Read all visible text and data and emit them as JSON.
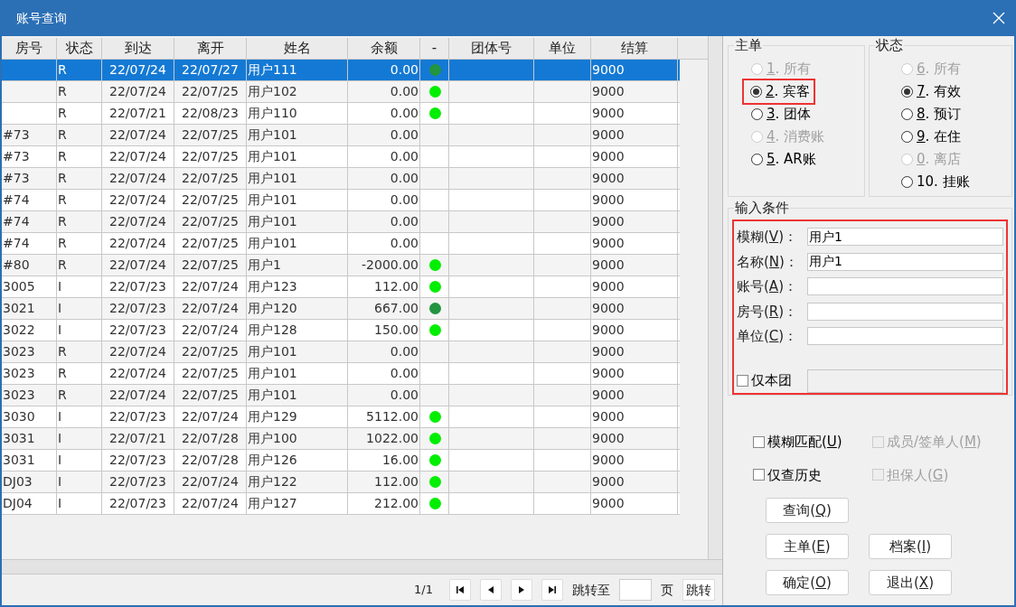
{
  "window": {
    "title": "账号查询"
  },
  "table": {
    "columns": [
      "房号",
      "状态",
      "到达",
      "离开",
      "姓名",
      "余额",
      "-",
      "团体号",
      "单位",
      "结算"
    ],
    "rows": [
      {
        "selected": true,
        "cells": [
          "",
          "R",
          "22/07/24",
          "22/07/27",
          "用户111",
          "0.00",
          "",
          "",
          "",
          "9000"
        ],
        "color": "#23943f"
      },
      {
        "selected": false,
        "cells": [
          "",
          "R",
          "22/07/24",
          "22/07/25",
          "用户102",
          "0.00",
          "",
          "",
          "",
          "9000"
        ],
        "color": "#00ee00"
      },
      {
        "selected": false,
        "cells": [
          "",
          "R",
          "22/07/21",
          "22/08/23",
          "用户110",
          "0.00",
          "",
          "",
          "",
          "9000"
        ],
        "color": "#00ee00"
      },
      {
        "selected": false,
        "cells": [
          "#73",
          "R",
          "22/07/24",
          "22/07/25",
          "用户101",
          "0.00",
          "",
          "",
          "",
          "9000"
        ]
      },
      {
        "selected": false,
        "cells": [
          "#73",
          "R",
          "22/07/24",
          "22/07/25",
          "用户101",
          "0.00",
          "",
          "",
          "",
          "9000"
        ]
      },
      {
        "selected": false,
        "cells": [
          "#73",
          "R",
          "22/07/24",
          "22/07/25",
          "用户101",
          "0.00",
          "",
          "",
          "",
          "9000"
        ]
      },
      {
        "selected": false,
        "cells": [
          "#74",
          "R",
          "22/07/24",
          "22/07/25",
          "用户101",
          "0.00",
          "",
          "",
          "",
          "9000"
        ]
      },
      {
        "selected": false,
        "cells": [
          "#74",
          "R",
          "22/07/24",
          "22/07/25",
          "用户101",
          "0.00",
          "",
          "",
          "",
          "9000"
        ]
      },
      {
        "selected": false,
        "cells": [
          "#74",
          "R",
          "22/07/24",
          "22/07/25",
          "用户101",
          "0.00",
          "",
          "",
          "",
          "9000"
        ]
      },
      {
        "selected": false,
        "cells": [
          "#80",
          "R",
          "22/07/24",
          "22/07/25",
          "用户1",
          "-2000.00",
          "",
          "",
          "",
          "9000"
        ],
        "color": "#00ee00"
      },
      {
        "selected": false,
        "cells": [
          "3005",
          "I",
          "22/07/23",
          "22/07/24",
          "用户123",
          "112.00",
          "",
          "",
          "",
          "9000"
        ],
        "color": "#00ee00"
      },
      {
        "selected": false,
        "cells": [
          "3021",
          "I",
          "22/07/23",
          "22/07/24",
          "用户120",
          "667.00",
          "",
          "",
          "",
          "9000"
        ],
        "color": "#23943f"
      },
      {
        "selected": false,
        "cells": [
          "3022",
          "I",
          "22/07/23",
          "22/07/24",
          "用户128",
          "150.00",
          "",
          "",
          "",
          "9000"
        ],
        "color": "#00ee00"
      },
      {
        "selected": false,
        "cells": [
          "3023",
          "R",
          "22/07/24",
          "22/07/25",
          "用户101",
          "0.00",
          "",
          "",
          "",
          "9000"
        ]
      },
      {
        "selected": false,
        "cells": [
          "3023",
          "R",
          "22/07/24",
          "22/07/25",
          "用户101",
          "0.00",
          "",
          "",
          "",
          "9000"
        ]
      },
      {
        "selected": false,
        "cells": [
          "3023",
          "R",
          "22/07/24",
          "22/07/25",
          "用户101",
          "0.00",
          "",
          "",
          "",
          "9000"
        ]
      },
      {
        "selected": false,
        "cells": [
          "3030",
          "I",
          "22/07/23",
          "22/07/24",
          "用户129",
          "5112.00",
          "",
          "",
          "",
          "9000"
        ],
        "color": "#00ee00"
      },
      {
        "selected": false,
        "cells": [
          "3031",
          "I",
          "22/07/21",
          "22/07/28",
          "用户100",
          "1022.00",
          "",
          "",
          "",
          "9000"
        ],
        "color": "#00ee00"
      },
      {
        "selected": false,
        "cells": [
          "3031",
          "I",
          "22/07/23",
          "22/07/28",
          "用户126",
          "16.00",
          "",
          "",
          "",
          "9000"
        ],
        "color": "#00ee00"
      },
      {
        "selected": false,
        "cells": [
          "DJ03",
          "I",
          "22/07/23",
          "22/07/24",
          "用户122",
          "112.00",
          "",
          "",
          "",
          "9000"
        ],
        "color": "#00ee00"
      },
      {
        "selected": false,
        "cells": [
          "DJ04",
          "I",
          "22/07/23",
          "22/07/24",
          "用户127",
          "212.00",
          "",
          "",
          "",
          "9000"
        ],
        "color": "#00ee00"
      }
    ]
  },
  "pager": {
    "page": "1/1",
    "goto_label": "跳转至",
    "page_unit": "页",
    "goto_button": "跳转"
  },
  "main_group": {
    "title": "主单",
    "options": [
      {
        "label": {
          "key": "1",
          "post": ". 所有"
        },
        "selected": false,
        "disabled": true
      },
      {
        "label": {
          "key": "2",
          "post": ". 宾客"
        },
        "selected": true,
        "disabled": false,
        "highlighted": true
      },
      {
        "label": {
          "key": "3",
          "post": ". 团体"
        },
        "selected": false,
        "disabled": false
      },
      {
        "label": {
          "key": "4",
          "post": ". 消费账"
        },
        "selected": false,
        "disabled": true
      },
      {
        "label": {
          "key": "5",
          "post": ". AR账"
        },
        "selected": false,
        "disabled": false
      }
    ]
  },
  "status_group": {
    "title": "状态",
    "options": [
      {
        "label": {
          "key": "6",
          "post": ". 所有"
        },
        "selected": false,
        "disabled": true
      },
      {
        "label": {
          "key": "7",
          "post": ". 有效"
        },
        "selected": true,
        "disabled": false
      },
      {
        "label": {
          "key": "8",
          "post": ". 预订"
        },
        "selected": false,
        "disabled": false
      },
      {
        "label": {
          "key": "9",
          "post": ". 在住"
        },
        "selected": false,
        "disabled": false
      },
      {
        "label": {
          "key": "0",
          "post": ". 离店"
        },
        "selected": false,
        "disabled": true
      },
      {
        "label": {
          "pre": "10. 挂账"
        },
        "selected": false,
        "disabled": false
      }
    ]
  },
  "conditions": {
    "title": "输入条件",
    "highlighted": true,
    "fields": [
      {
        "label": {
          "pre": "模糊(",
          "key": "V",
          "post": ")："
        },
        "value": "用户1"
      },
      {
        "label": {
          "pre": "名称(",
          "key": "N",
          "post": ")："
        },
        "value": "用户1"
      },
      {
        "label": {
          "pre": "账号(",
          "key": "A",
          "post": ")："
        }
      },
      {
        "label": {
          "pre": "房号(",
          "key": "R",
          "post": ")："
        }
      },
      {
        "label": {
          "pre": "单位(",
          "key": "C",
          "post": ")："
        }
      }
    ],
    "group_only": {
      "label": {
        "pre": "仅本团"
      },
      "checked": false
    }
  },
  "options": [
    {
      "label": {
        "pre": "模糊匹配(",
        "key": "U",
        "post": ")"
      },
      "checked": false,
      "disabled": false
    },
    {
      "label": {
        "pre": "成员/签单人(",
        "key": "M",
        "post": ")"
      },
      "checked": false,
      "disabled": true
    },
    {
      "label": {
        "pre": "仅查历史"
      },
      "checked": false,
      "disabled": false
    },
    {
      "label": {
        "pre": "担保人(",
        "key": "G",
        "post": ")"
      },
      "checked": false,
      "disabled": true
    }
  ],
  "buttons": [
    {
      "label": {
        "pre": "查询(",
        "key": "Q",
        "post": ")"
      }
    },
    {
      "label": {
        "pre": "主单(",
        "key": "E",
        "post": ")"
      }
    },
    {
      "label": {
        "pre": "档案(",
        "key": "I",
        "post": ")"
      }
    },
    {
      "label": {
        "pre": "确定(",
        "key": "O",
        "post": ")"
      }
    },
    {
      "label": {
        "pre": "退出(",
        "key": "X",
        "post": ")"
      }
    }
  ]
}
